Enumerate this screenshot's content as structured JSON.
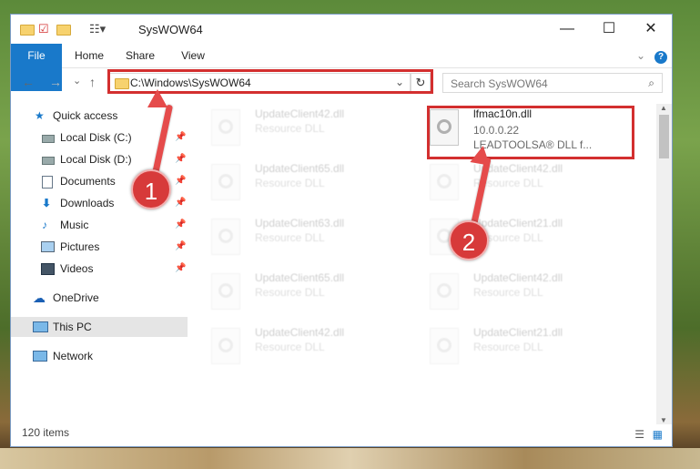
{
  "window": {
    "title": "SysWOW64"
  },
  "controls": {
    "minimize": "—",
    "maximize": "☐",
    "close": "✕"
  },
  "ribbon": {
    "tabs": [
      "File",
      "Home",
      "Share",
      "View"
    ],
    "expand": "⌄",
    "help": "?"
  },
  "nav": {
    "back": "←",
    "forward": "→",
    "recent": "⌄",
    "up": "↑",
    "address": "C:\\Windows\\SysWOW64",
    "dropdown": "⌄",
    "refresh": "↻",
    "search_placeholder": "Search SysWOW64"
  },
  "sidebar": {
    "items": [
      {
        "label": "Quick access",
        "icon": "star-icon"
      },
      {
        "label": "Local Disk (C:)",
        "icon": "drive-icon"
      },
      {
        "label": "Local Disk (D:)",
        "icon": "drive-icon"
      },
      {
        "label": "Documents",
        "icon": "documents-icon"
      },
      {
        "label": "Downloads",
        "icon": "downloads-icon"
      },
      {
        "label": "Music",
        "icon": "music-icon"
      },
      {
        "label": "Pictures",
        "icon": "pictures-icon"
      },
      {
        "label": "Videos",
        "icon": "videos-icon"
      },
      {
        "label": "OneDrive",
        "icon": "cloud-icon"
      },
      {
        "label": "This PC",
        "icon": "computer-icon"
      },
      {
        "label": "Network",
        "icon": "network-icon"
      }
    ]
  },
  "files": [
    {
      "name": "UpdateClient42.dll",
      "sub": "Resource DLL"
    },
    {
      "name": "lfmac10n.dll",
      "version": "10.0.0.22",
      "desc": "LEADTOOLSA® DLL f..."
    },
    {
      "name": "UpdateClient65.dll",
      "sub": "Resource DLL"
    },
    {
      "name": "UpdateClient42.dll",
      "sub": "Resource DLL"
    },
    {
      "name": "UpdateClient63.dll",
      "sub": "Resource DLL"
    },
    {
      "name": "UpdateClient21.dll",
      "sub": "Resource DLL"
    },
    {
      "name": "UpdateClient65.dll",
      "sub": "Resource DLL"
    },
    {
      "name": "UpdateClient42.dll",
      "sub": "Resource DLL"
    },
    {
      "name": "UpdateClient42.dll",
      "sub": "Resource DLL"
    },
    {
      "name": "UpdateClient21.dll",
      "sub": "Resource DLL"
    }
  ],
  "status": {
    "count": "120 items"
  },
  "annotations": {
    "badge1": "1",
    "badge2": "2"
  },
  "colors": {
    "accent": "#1979ca",
    "annotation": "#d32f2f"
  }
}
